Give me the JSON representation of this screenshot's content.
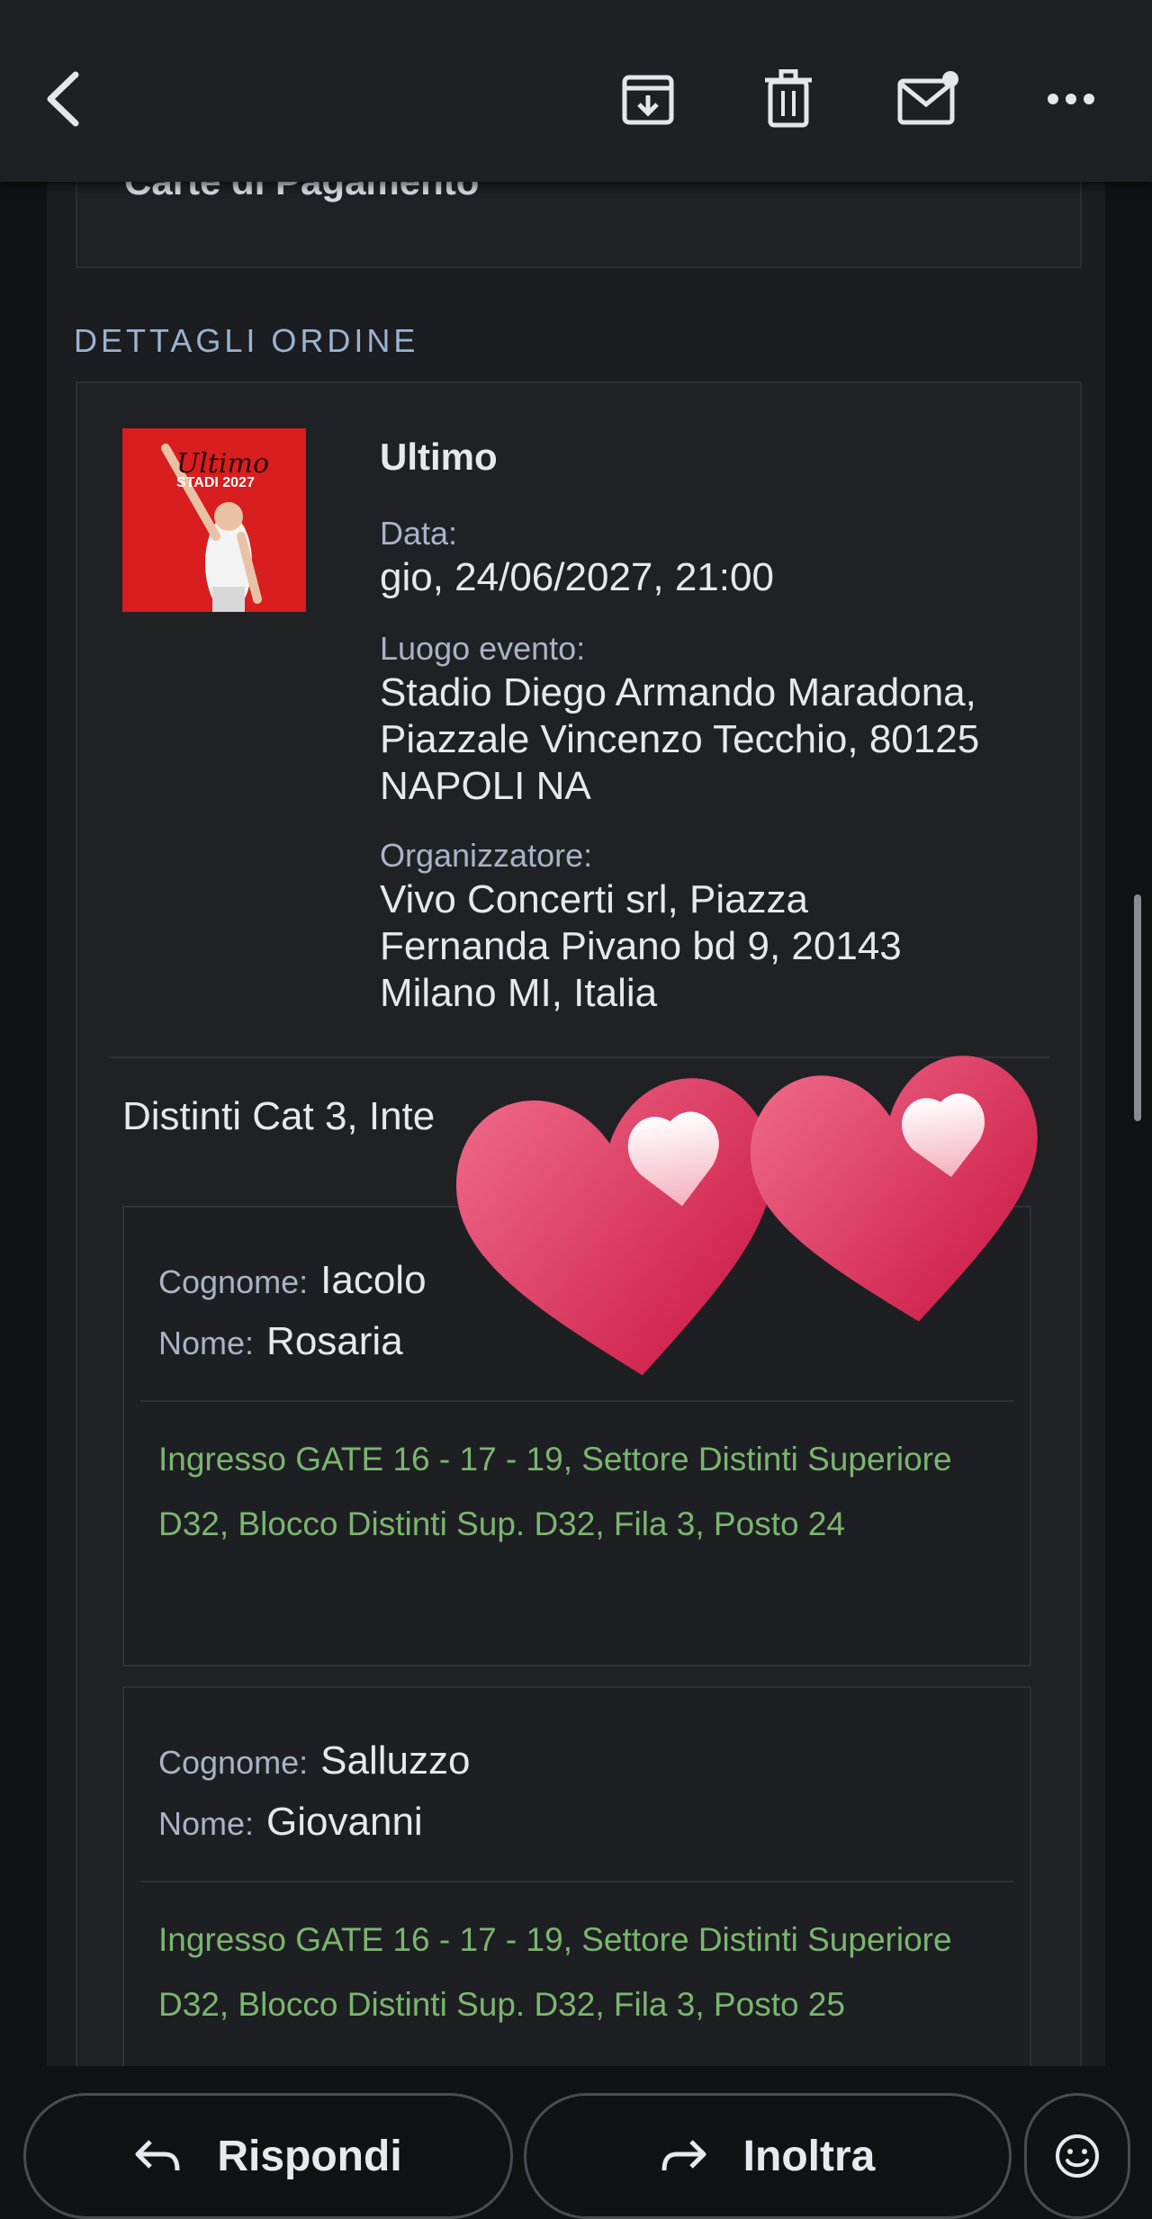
{
  "topbar": {
    "icons": [
      "back-arrow-icon",
      "archive-icon",
      "trash-icon",
      "mark-unread-icon",
      "more-icon"
    ]
  },
  "card_top": {
    "title": "Carte di Pagamento"
  },
  "order": {
    "section_label": "DETTAGLI ORDINE",
    "poster": {
      "line1": "Ultimo",
      "line2": "STADI 2027"
    },
    "event_title": "Ultimo",
    "date_label": "Data:",
    "date_value": "gio, 24/06/2027, 21:00",
    "venue_label": "Luogo evento:",
    "venue_lines": [
      "Stadio Diego Armando Maradona,",
      "Piazzale Vincenzo Tecchio, 80125",
      "NAPOLI NA"
    ],
    "organizer_label": "Organizzatore:",
    "organizer_lines": [
      "Vivo Concerti srl, Piazza",
      "Fernanda Pivano bd 9, 20143",
      "Milano MI, Italia"
    ],
    "ticket_category": "Distinti Cat 3, Inte",
    "tickets": [
      {
        "surname_label": "Cognome:",
        "surname": "Iacolo",
        "name_label": "Nome:",
        "name": "Rosaria",
        "note": "Ingresso GATE 16 - 17 - 19, Settore Distinti Superiore D32, Blocco Distinti Sup. D32, Fila 3, Posto 24"
      },
      {
        "surname_label": "Cognome:",
        "surname": "Salluzzo",
        "name_label": "Nome:",
        "name": "Giovanni",
        "note": "Ingresso GATE 16 - 17 - 19, Settore Distinti Superiore D32, Blocco Distinti Sup. D32, Fila 3, Posto 25"
      }
    ]
  },
  "bottombar": {
    "reply_label": "Rispondi",
    "forward_label": "Inoltra",
    "reply_icon": "reply-arrow-icon",
    "forward_icon": "forward-arrow-icon",
    "emoji_icon": "emoji-icon"
  },
  "colors": {
    "background": "#111214",
    "panel": "#1c1d21",
    "label": "#aab3c6",
    "section": "#9bb3d0",
    "seat_note": "#7bb66f",
    "heart": "#e0335a"
  }
}
